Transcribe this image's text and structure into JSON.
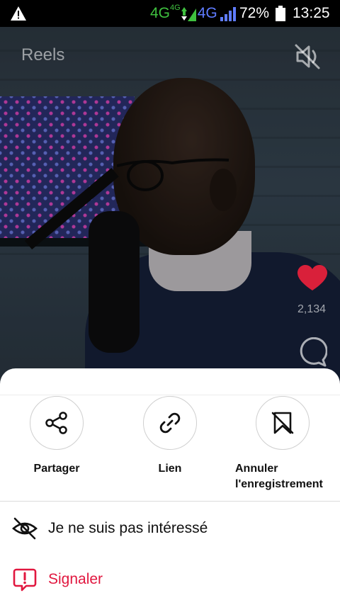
{
  "status_bar": {
    "network_1": "4G",
    "network_1_sup": "4G",
    "network_2": "4G",
    "battery": "72%",
    "time": "13:25",
    "icons": [
      "warning-icon",
      "signal-icon",
      "battery-icon"
    ]
  },
  "reel": {
    "title": "Reels",
    "likes": "2,134",
    "icons": [
      "mute-icon",
      "heart-icon",
      "comment-icon"
    ],
    "colors": {
      "heart": "#d9203a"
    }
  },
  "sheet": {
    "actions": [
      {
        "label": "Partager",
        "icon": "share-icon"
      },
      {
        "label": "Lien",
        "icon": "link-icon"
      },
      {
        "label": "Annuler l'enregistrement",
        "icon": "unsave-icon"
      }
    ],
    "menu": [
      {
        "label": "Je ne suis pas intéressé",
        "icon": "eye-off-icon"
      },
      {
        "label": "Signaler",
        "icon": "report-icon"
      }
    ],
    "colors": {
      "report": "#e1173f"
    }
  }
}
